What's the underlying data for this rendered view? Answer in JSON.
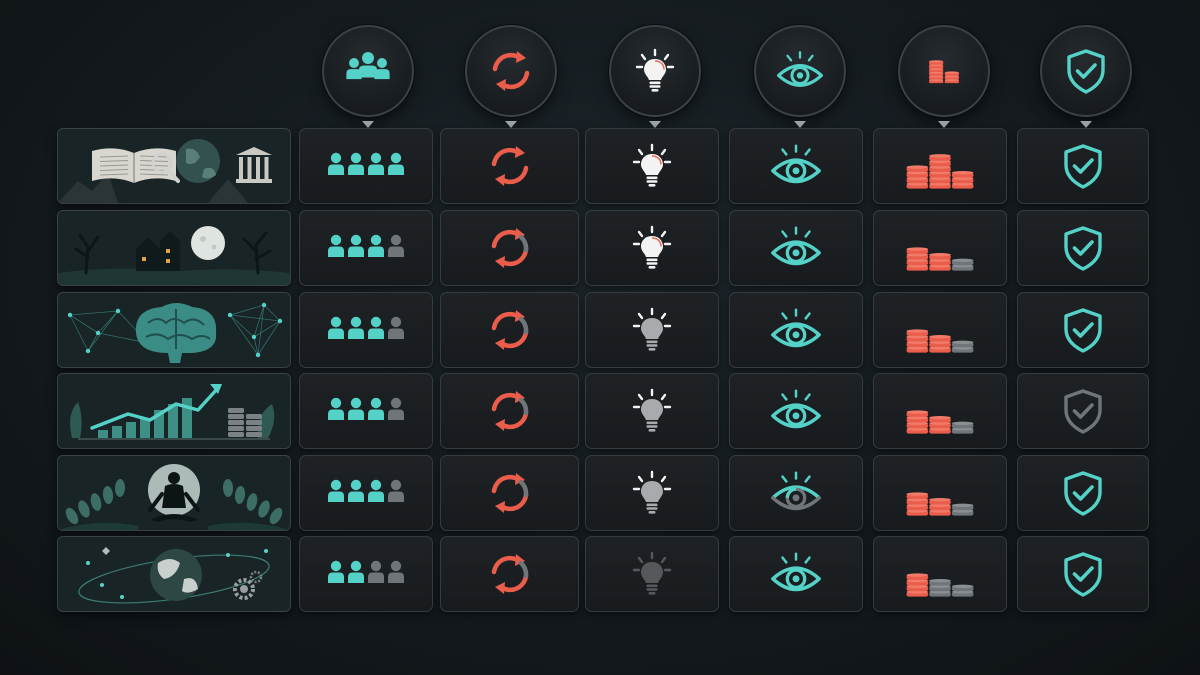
{
  "colors": {
    "teal": "#55d2c8",
    "coral": "#ea5d4b",
    "gray": "#6f7579",
    "white": "#f3f3f3",
    "light_gray": "#a7abad",
    "dark_gray": "#55595c"
  },
  "columns": [
    {
      "icon": "people-icon",
      "key": "people"
    },
    {
      "icon": "refresh-icon",
      "key": "cycle"
    },
    {
      "icon": "lightbulb-icon",
      "key": "idea"
    },
    {
      "icon": "eye-icon",
      "key": "visibility"
    },
    {
      "icon": "coins-icon",
      "key": "cost"
    },
    {
      "icon": "shield-check-icon",
      "key": "security"
    }
  ],
  "rows": [
    {
      "image": "books-globe-landmarks-image",
      "people_filled": 4,
      "cycle_filled": 4,
      "idea_level": "bright",
      "eye_state": "full",
      "coin_stacks_filled": 3,
      "shield_state": "active"
    },
    {
      "image": "haunted-house-moon-image",
      "people_filled": 3,
      "cycle_filled": 3,
      "idea_level": "bright",
      "eye_state": "full",
      "coin_stacks_filled": 2,
      "shield_state": "active"
    },
    {
      "image": "brain-network-image",
      "people_filled": 3,
      "cycle_filled": 3,
      "idea_level": "medium",
      "eye_state": "full",
      "coin_stacks_filled": 2,
      "shield_state": "active"
    },
    {
      "image": "growth-chart-image",
      "people_filled": 3,
      "cycle_filled": 3,
      "idea_level": "medium",
      "eye_state": "full",
      "coin_stacks_filled": 1.5,
      "shield_state": "inactive"
    },
    {
      "image": "meditation-moon-image",
      "people_filled": 3,
      "cycle_filled": 3,
      "idea_level": "medium",
      "eye_state": "partial",
      "coin_stacks_filled": 2,
      "shield_state": "active"
    },
    {
      "image": "globe-orbit-gears-image",
      "people_filled": 2,
      "cycle_filled": 3,
      "idea_level": "dim",
      "eye_state": "full",
      "coin_stacks_filled": 1,
      "shield_state": "active"
    }
  ]
}
